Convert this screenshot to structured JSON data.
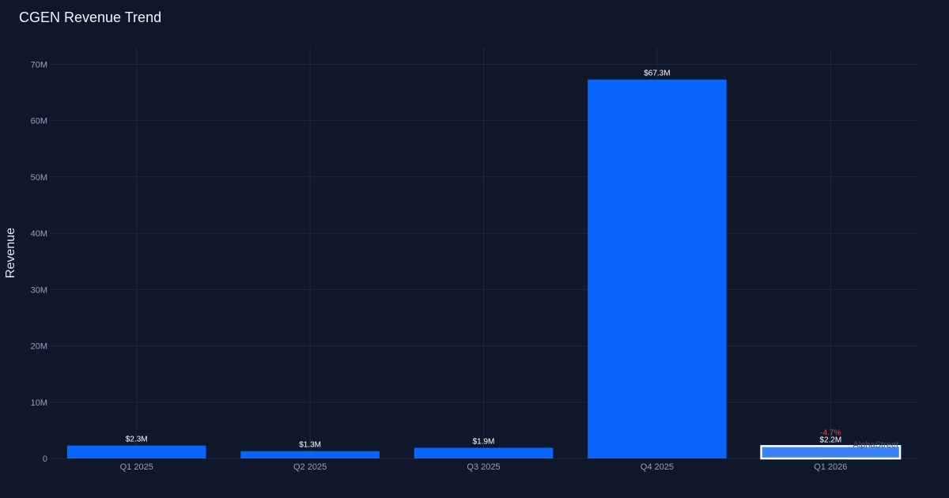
{
  "chart_data": {
    "type": "bar",
    "title": "CGEN Revenue Trend",
    "xlabel": "",
    "ylabel": "Revenue",
    "categories": [
      "Q1 2025",
      "Q2 2025",
      "Q3 2025",
      "Q4 2025",
      "Q1 2026"
    ],
    "values": [
      2.3,
      1.3,
      1.9,
      67.3,
      2.2
    ],
    "value_unit": "M",
    "data_labels": [
      "$2.3M",
      "$1.3M",
      "$1.9M",
      "$67.3M",
      "$2.2M"
    ],
    "ylim": [
      0,
      73
    ],
    "yticks": [
      0,
      10,
      20,
      30,
      40,
      50,
      60,
      70
    ],
    "ytick_labels": [
      "0",
      "10M",
      "20M",
      "30M",
      "40M",
      "50M",
      "60M",
      "70M"
    ],
    "grid": true,
    "highlighted_category": "Q1 2026",
    "annotation": {
      "category": "Q1 2026",
      "text": "-4.7%"
    },
    "watermark": "AlphaStreet",
    "colors": {
      "background": "#0f172a",
      "bar": "#0866ff",
      "bar_highlight": "#3b82f6",
      "highlight_border": "#ffffff",
      "grid": "#1e293b",
      "negative": "#ef4444"
    }
  }
}
